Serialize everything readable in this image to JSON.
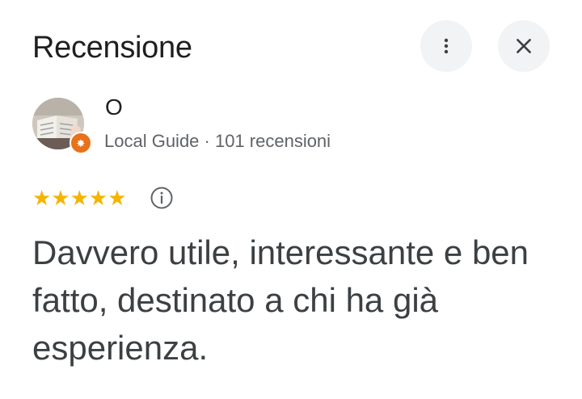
{
  "header": {
    "title": "Recensione",
    "more_icon": "more-vert-icon",
    "close_icon": "close-icon"
  },
  "reviewer": {
    "name": "O",
    "meta": "Local Guide · 101 recensioni",
    "badge_icon": "local-guide-star-icon",
    "badge_color": "#e8711a"
  },
  "review": {
    "stars": "★★★★★",
    "rating": 5,
    "star_color": "#f4b400",
    "info_icon": "info-icon",
    "date": "",
    "text": "Davvero utile, interessante e ben fatto, destinato a chi ha già esperienza."
  }
}
